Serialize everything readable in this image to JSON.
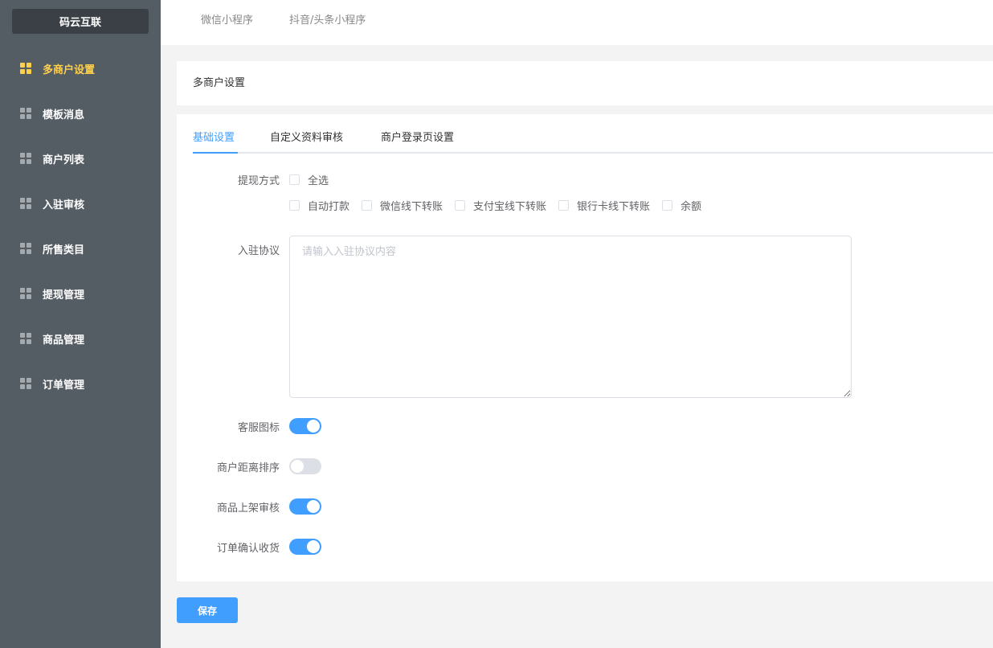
{
  "brand": "码云互联",
  "sidebar": {
    "items": [
      {
        "label": "多商户设置",
        "active": true
      },
      {
        "label": "模板消息"
      },
      {
        "label": "商户列表"
      },
      {
        "label": "入驻审核"
      },
      {
        "label": "所售类目"
      },
      {
        "label": "提现管理"
      },
      {
        "label": "商品管理"
      },
      {
        "label": "订单管理"
      }
    ]
  },
  "topbar": {
    "tabs": [
      "微信小程序",
      "抖音/头条小程序"
    ]
  },
  "header": {
    "title": "多商户设置"
  },
  "tabs": {
    "items": [
      "基础设置",
      "自定义资料审核",
      "商户登录页设置"
    ],
    "active": 0
  },
  "form": {
    "withdraw_label": "提现方式",
    "select_all": "全选",
    "methods": [
      "自动打款",
      "微信线下转账",
      "支付宝线下转账",
      "银行卡线下转账",
      "余额"
    ],
    "agreement_label": "入驻协议",
    "agreement_placeholder": "请输入入驻协议内容",
    "agreement_value": "",
    "switches": [
      {
        "label": "客服图标",
        "on": true
      },
      {
        "label": "商户距离排序",
        "on": false
      },
      {
        "label": "商品上架审核",
        "on": true
      },
      {
        "label": "订单确认收货",
        "on": true
      }
    ]
  },
  "save_label": "保存",
  "colors": {
    "sidebar": "#545c64",
    "active": "#ffd04b",
    "primary": "#409eff"
  }
}
